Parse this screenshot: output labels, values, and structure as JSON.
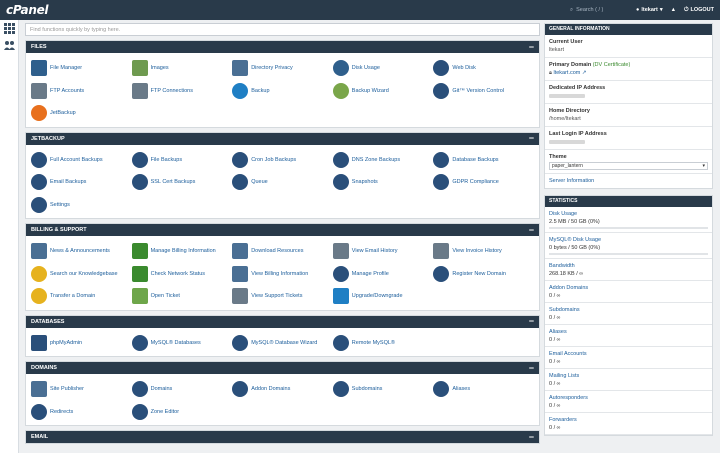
{
  "topbar": {
    "logo": "cPanel",
    "search_placeholder": "Search ( / )",
    "user": "ltekart",
    "logout": "LOGOUT"
  },
  "search": {
    "placeholder": "Find functions quickly by typing here."
  },
  "panels": [
    {
      "title": "Files",
      "items": [
        {
          "label": "File Manager",
          "icon": "file-manager-icon",
          "color": "#2f5f8c",
          "shape": "sq"
        },
        {
          "label": "Images",
          "icon": "images-icon",
          "color": "#6e9a4f",
          "shape": "sq"
        },
        {
          "label": "Directory Privacy",
          "icon": "directory-privacy-icon",
          "color": "#4a6f94",
          "shape": "sq"
        },
        {
          "label": "Disk Usage",
          "icon": "disk-usage-icon",
          "color": "#2f5f8c",
          "shape": "round"
        },
        {
          "label": "Web Disk",
          "icon": "web-disk-icon",
          "color": "#2a4f7a",
          "shape": "round"
        },
        {
          "label": "FTP Accounts",
          "icon": "ftp-accounts-icon",
          "color": "#6a7a88",
          "shape": "sq"
        },
        {
          "label": "FTP Connections",
          "icon": "ftp-connections-icon",
          "color": "#6a7a88",
          "shape": "sq"
        },
        {
          "label": "Backup",
          "icon": "backup-icon",
          "color": "#1f7fc4",
          "shape": "round"
        },
        {
          "label": "Backup Wizard",
          "icon": "backup-wizard-icon",
          "color": "#7aa64a",
          "shape": "round"
        },
        {
          "label": "Git™ Version Control",
          "icon": "git-icon",
          "color": "#2a4f7a",
          "shape": "round"
        },
        {
          "label": "JetBackup",
          "icon": "jetbackup-icon",
          "color": "#e8701d",
          "shape": "round"
        }
      ]
    },
    {
      "title": "JetBackup",
      "items": [
        {
          "label": "Full Account Backups",
          "icon": "full-account-backups-icon",
          "color": "#2a4f7a",
          "shape": "round"
        },
        {
          "label": "File Backups",
          "icon": "file-backups-icon",
          "color": "#2a4f7a",
          "shape": "round"
        },
        {
          "label": "Cron Job Backups",
          "icon": "cron-job-backups-icon",
          "color": "#2a4f7a",
          "shape": "round"
        },
        {
          "label": "DNS Zone Backups",
          "icon": "dns-zone-backups-icon",
          "color": "#2a4f7a",
          "shape": "round"
        },
        {
          "label": "Database Backups",
          "icon": "database-backups-icon",
          "color": "#2a4f7a",
          "shape": "round"
        },
        {
          "label": "Email Backups",
          "icon": "email-backups-icon",
          "color": "#2a4f7a",
          "shape": "round"
        },
        {
          "label": "SSL Cert Backups",
          "icon": "ssl-cert-backups-icon",
          "color": "#2a4f7a",
          "shape": "round"
        },
        {
          "label": "Queue",
          "icon": "queue-icon",
          "color": "#2a4f7a",
          "shape": "round"
        },
        {
          "label": "Snapshots",
          "icon": "snapshots-icon",
          "color": "#2a4f7a",
          "shape": "round"
        },
        {
          "label": "GDPR Compliance",
          "icon": "gdpr-compliance-icon",
          "color": "#2a4f7a",
          "shape": "round"
        },
        {
          "label": "Settings",
          "icon": "settings-icon",
          "color": "#2a4f7a",
          "shape": "round"
        }
      ]
    },
    {
      "title": "Billing & Support",
      "items": [
        {
          "label": "News & Announcements",
          "icon": "news-icon",
          "color": "#4a6f94",
          "shape": "sq"
        },
        {
          "label": "Manage Billing Information",
          "icon": "manage-billing-icon",
          "color": "#3a8a2e",
          "shape": "sq"
        },
        {
          "label": "Download Resources",
          "icon": "download-resources-icon",
          "color": "#4a6f94",
          "shape": "sq"
        },
        {
          "label": "View Email History",
          "icon": "view-email-history-icon",
          "color": "#6a7a88",
          "shape": "sq"
        },
        {
          "label": "View Invoice History",
          "icon": "view-invoice-history-icon",
          "color": "#6a7a88",
          "shape": "sq"
        },
        {
          "label": "Search our Knowledgebase",
          "icon": "knowledgebase-icon",
          "color": "#e6b21e",
          "shape": "round"
        },
        {
          "label": "Check Network Status",
          "icon": "network-status-icon",
          "color": "#3a8a2e",
          "shape": "sq"
        },
        {
          "label": "View Billing Information",
          "icon": "view-billing-icon",
          "color": "#4a6f94",
          "shape": "sq"
        },
        {
          "label": "Manage Profile",
          "icon": "manage-profile-icon",
          "color": "#2a4f7a",
          "shape": "round"
        },
        {
          "label": "Register New Domain",
          "icon": "register-domain-icon",
          "color": "#2a4f7a",
          "shape": "round"
        },
        {
          "label": "Transfer a Domain",
          "icon": "transfer-domain-icon",
          "color": "#e6b21e",
          "shape": "round"
        },
        {
          "label": "Open Ticket",
          "icon": "open-ticket-icon",
          "color": "#6ea64a",
          "shape": "sq"
        },
        {
          "label": "View Support Tickets",
          "icon": "support-tickets-icon",
          "color": "#6a7a88",
          "shape": "sq"
        },
        {
          "label": "Upgrade/Downgrade",
          "icon": "upgrade-downgrade-icon",
          "color": "#1f7fc4",
          "shape": "sq"
        }
      ]
    },
    {
      "title": "Databases",
      "items": [
        {
          "label": "phpMyAdmin",
          "icon": "phpmyadmin-icon",
          "color": "#2a4f7a",
          "shape": "sq"
        },
        {
          "label": "MySQL® Databases",
          "icon": "mysql-databases-icon",
          "color": "#2a4f7a",
          "shape": "round"
        },
        {
          "label": "MySQL® Database Wizard",
          "icon": "mysql-wizard-icon",
          "color": "#2a4f7a",
          "shape": "round"
        },
        {
          "label": "Remote MySQL®",
          "icon": "remote-mysql-icon",
          "color": "#2a4f7a",
          "shape": "round"
        }
      ]
    },
    {
      "title": "Domains",
      "items": [
        {
          "label": "Site Publisher",
          "icon": "site-publisher-icon",
          "color": "#4a6f94",
          "shape": "sq"
        },
        {
          "label": "Domains",
          "icon": "domains-icon",
          "color": "#2a4f7a",
          "shape": "round"
        },
        {
          "label": "Addon Domains",
          "icon": "addon-domains-icon",
          "color": "#2a4f7a",
          "shape": "round"
        },
        {
          "label": "Subdomains",
          "icon": "subdomains-icon",
          "color": "#2a4f7a",
          "shape": "round"
        },
        {
          "label": "Aliases",
          "icon": "aliases-icon",
          "color": "#2a4f7a",
          "shape": "round"
        },
        {
          "label": "Redirects",
          "icon": "redirects-icon",
          "color": "#2a4f7a",
          "shape": "round"
        },
        {
          "label": "Zone Editor",
          "icon": "zone-editor-icon",
          "color": "#2a4f7a",
          "shape": "round"
        }
      ]
    },
    {
      "title": "Email",
      "items": []
    }
  ],
  "general": {
    "title": "General Information",
    "current_user_label": "Current User",
    "current_user": "ltekart",
    "primary_domain_label": "Primary Domain",
    "primary_domain_cert": "(DV Certificate)",
    "primary_domain": "ltekart.com",
    "dedicated_ip_label": "Dedicated IP Address",
    "home_dir_label": "Home Directory",
    "home_dir": "/home/ltekart",
    "last_login_label": "Last Login IP Address",
    "theme_label": "Theme",
    "theme_value": "paper_lantern",
    "server_info": "Server Information"
  },
  "stats": {
    "title": "Statistics",
    "items": [
      {
        "label": "Disk Usage",
        "value": "2.5 MB / 50 GB   (0%)",
        "fraction": 0.0
      },
      {
        "label": "MySQL® Disk Usage",
        "value": "0 bytes / 50 GB   (0%)",
        "fraction": 0.0
      },
      {
        "label": "Bandwidth",
        "value": "268.18 KB / ∞"
      },
      {
        "label": "Addon Domains",
        "value": "0 / ∞"
      },
      {
        "label": "Subdomains",
        "value": "0 / ∞"
      },
      {
        "label": "Aliases",
        "value": "0 / ∞"
      },
      {
        "label": "Email Accounts",
        "value": "0 / ∞"
      },
      {
        "label": "Mailing Lists",
        "value": "0 / ∞"
      },
      {
        "label": "Autoresponders",
        "value": "0 / ∞"
      },
      {
        "label": "Forwarders",
        "value": "0 / ∞"
      }
    ]
  }
}
